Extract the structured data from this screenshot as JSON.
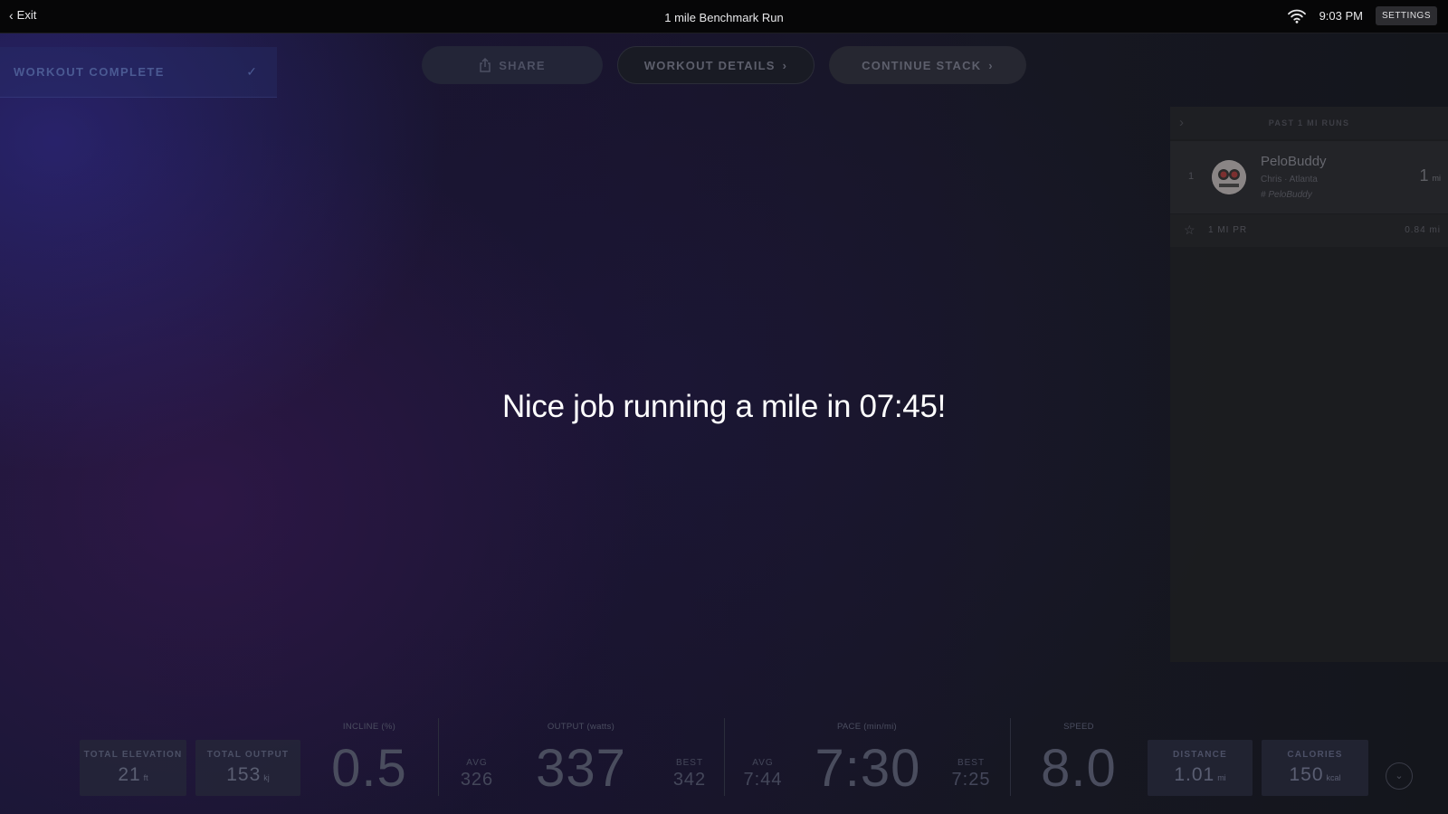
{
  "topbar": {
    "exit_label": "Exit",
    "class_title": "1 mile Benchmark Run",
    "time": "9:03 PM",
    "settings_label": "SETTINGS"
  },
  "status": {
    "workout_complete_label": "WORKOUT COMPLETE"
  },
  "actions": {
    "share_label": "SHARE",
    "details_label": "WORKOUT DETAILS",
    "continue_label": "CONTINUE STACK"
  },
  "leaderboard": {
    "title": "PAST 1 MI RUNS",
    "rank": "1",
    "username": "PeloBuddy",
    "location": "Chris · Atlanta",
    "tag": "# PeloBuddy",
    "distance_value": "1",
    "distance_unit": "mi",
    "pr_label": "1 MI PR",
    "pr_value": "0.84 mi"
  },
  "message": "Nice job running a mile in 07:45!",
  "metrics": {
    "total_elevation": {
      "label": "TOTAL ELEVATION",
      "value": "21",
      "unit": "ft"
    },
    "total_output": {
      "label": "TOTAL OUTPUT",
      "value": "153",
      "unit": "kj"
    },
    "incline": {
      "label": "INCLINE (%)",
      "value": "0.5"
    },
    "output": {
      "label": "OUTPUT (watts)",
      "avg_label": "AVG",
      "avg": "326",
      "value": "337",
      "best_label": "BEST",
      "best": "342"
    },
    "pace": {
      "label": "PACE (min/mi)",
      "avg_label": "AVG",
      "avg": "7:44",
      "value": "7:30",
      "best_label": "BEST",
      "best": "7:25"
    },
    "speed": {
      "label": "SPEED",
      "value": "8.0"
    },
    "distance": {
      "label": "DISTANCE",
      "value": "1.01",
      "unit": "mi"
    },
    "calories": {
      "label": "CALORIES",
      "value": "150",
      "unit": "kcal"
    }
  },
  "colors": {
    "accent_blue": "#2c2c96",
    "message_text": "#ffffff"
  }
}
